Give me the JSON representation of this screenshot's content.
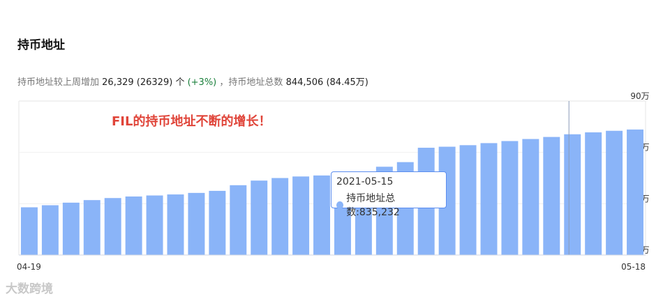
{
  "page": {
    "title": "持币地址",
    "summary": {
      "prefix": "持币地址较上周增加",
      "increase": "26,329",
      "increase_raw": "(26329)",
      "unit": "个",
      "percent": "(+3%)",
      "total_label": "，持币地址总数",
      "total": "844,506",
      "total_wan": "(84.45万)"
    },
    "watermark": "大数跨境"
  },
  "colors": {
    "bar": "#8ab4f8",
    "annotation": "#e0453a",
    "positive": "#1a7f3b",
    "tooltip_border": "#5b8def"
  },
  "chart_data": {
    "type": "bar",
    "annotation": "FIL的持币地址不断的增长！",
    "x_start_label": "04-19",
    "x_end_label": "05-18",
    "y_ticks": [
      "60万",
      "70万",
      "80万",
      "90万"
    ],
    "ylim": [
      600000,
      900000
    ],
    "values": [
      693000,
      697000,
      702000,
      707000,
      711000,
      714000,
      716000,
      718000,
      721000,
      725000,
      736000,
      745000,
      750000,
      753000,
      755000,
      758000,
      762000,
      772000,
      781000,
      809000,
      811000,
      814000,
      818000,
      822000,
      826000,
      830000,
      835232,
      839000,
      842000,
      844506
    ],
    "highlight_index": 26,
    "tooltip": {
      "date": "2021-05-15",
      "label": "持币地址总数:835,232"
    }
  }
}
